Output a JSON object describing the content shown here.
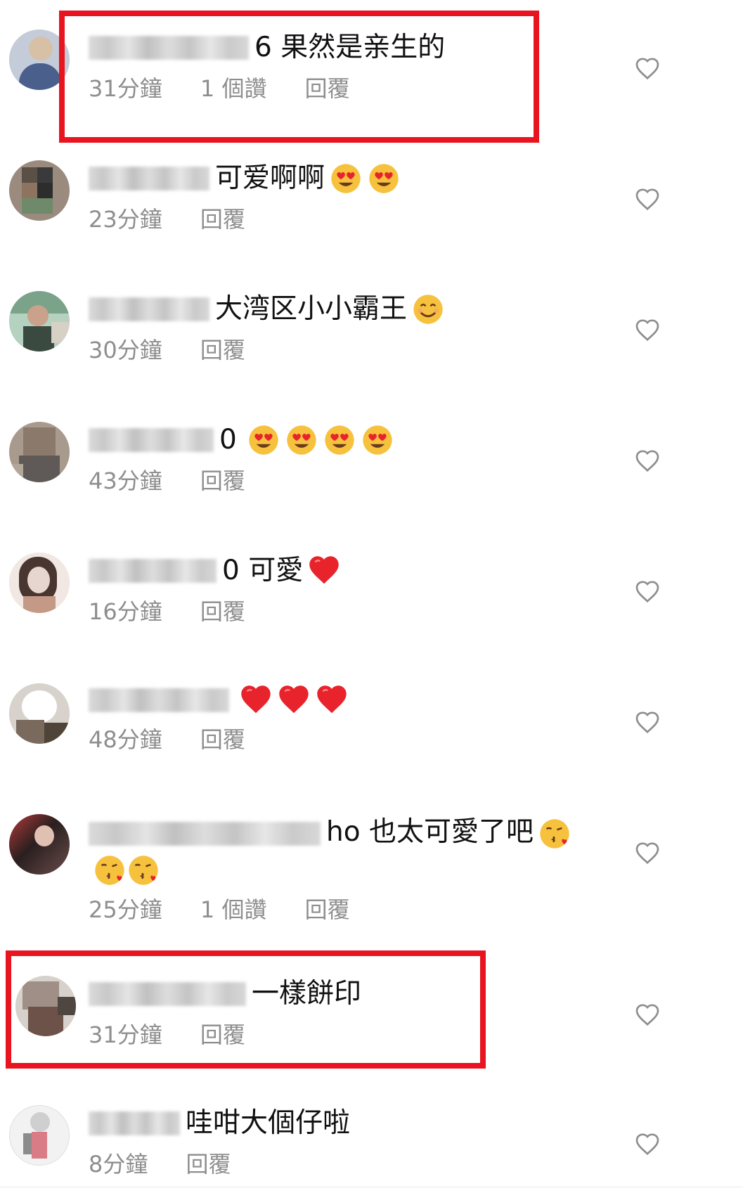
{
  "comments": [
    {
      "text": "6 果然是亲生的",
      "emojis": [],
      "time": "31分鐘",
      "likes": "1 個讚",
      "reply": "回覆",
      "avatar": [
        "#4b5f8c",
        "#7d8fb8",
        "#d8c0a6",
        "#3d4a6b"
      ]
    },
    {
      "text": "可爱啊啊",
      "emojis": [
        "heart-eyes-emoji",
        "heart-eyes-emoji"
      ],
      "time": "23分鐘",
      "likes": "",
      "reply": "回覆",
      "avatar": [
        "#5b5046",
        "#8c7460",
        "#2d2d2d",
        "#6f8a6b"
      ]
    },
    {
      "text": "大湾区小小霸王",
      "emojis": [
        "smiling-face-emoji"
      ],
      "time": "30分鐘",
      "likes": "",
      "reply": "回覆",
      "avatar": [
        "#7aa38a",
        "#caa18a",
        "#3b4a40",
        "#d7d0c4"
      ]
    },
    {
      "text": "0",
      "emojis": [
        "heart-eyes-emoji",
        "heart-eyes-emoji",
        "heart-eyes-emoji",
        "heart-eyes-emoji"
      ],
      "time": "43分鐘",
      "likes": "",
      "reply": "回覆",
      "avatar": [
        "#8b7a6c",
        "#5f5a57",
        "#b3a79b",
        "#3c3a3a"
      ]
    },
    {
      "text": "0 可愛",
      "emojis": [
        "red-heart-emoji"
      ],
      "time": "16分鐘",
      "likes": "",
      "reply": "回覆",
      "avatar": [
        "#e6d6cf",
        "#4a3630",
        "#c49a86",
        "#f1e8e4"
      ]
    },
    {
      "text": "",
      "emojis": [
        "red-heart-emoji",
        "red-heart-emoji",
        "red-heart-emoji"
      ],
      "time": "48分鐘",
      "likes": "",
      "reply": "回覆",
      "avatar": [
        "#ffffff",
        "#7a6a5e",
        "#d8d2cc",
        "#4e4438"
      ]
    },
    {
      "text": "ho 也太可愛了吧",
      "emojis": [
        "kissing-face-emoji",
        "kissing-face-emoji",
        "kissing-face-emoji"
      ],
      "time": "25分鐘",
      "likes": "1 個讚",
      "reply": "回覆",
      "avatar": [
        "#b43a3a",
        "#2a1f1f",
        "#e0c0b0",
        "#6b4c4c"
      ]
    },
    {
      "text": "一樣餅印",
      "emojis": [],
      "time": "31分鐘",
      "likes": "",
      "reply": "回覆",
      "avatar": [
        "#9f8f86",
        "#6c5248",
        "#d7d1cb",
        "#4f4541"
      ]
    },
    {
      "text": "哇咁大個仔啦",
      "emojis": [],
      "time": "8分鐘",
      "likes": "",
      "reply": "回覆",
      "avatar": [
        "#f2f2f2",
        "#d97c85",
        "#cfcfcf",
        "#8c8c8c"
      ]
    }
  ],
  "colors": {
    "highlight": "#e8141f",
    "meta_text": "#8e8e8e",
    "comment_text": "#111111"
  },
  "icons": {
    "like": "heart-outline-icon"
  }
}
